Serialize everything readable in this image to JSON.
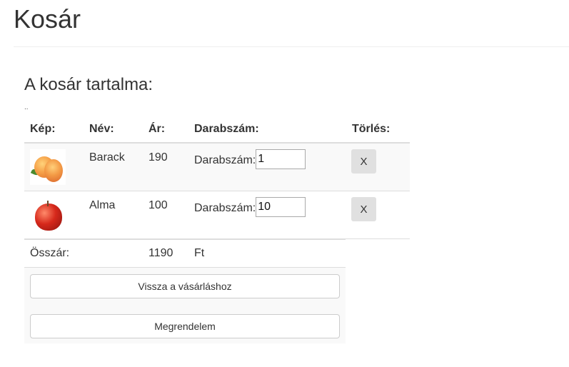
{
  "page": {
    "title": "Kosár",
    "subtitle": "A kosár tartalma:",
    "stray_text": ".."
  },
  "table": {
    "headers": {
      "image": "Kép:",
      "name": "Név:",
      "price": "Ár:",
      "quantity": "Darabszám:",
      "delete": "Törlés:"
    },
    "rows": [
      {
        "icon": "peach-icon",
        "name": "Barack",
        "price": "190",
        "qty_label": "Darabszám:",
        "qty_value": "1",
        "delete_label": "X"
      },
      {
        "icon": "apple-icon",
        "name": "Alma",
        "price": "100",
        "qty_label": "Darabszám:",
        "qty_value": "10",
        "delete_label": "X"
      }
    ],
    "total": {
      "label": "Összár:",
      "value": "1190",
      "currency": "Ft"
    }
  },
  "actions": {
    "back_label": "Vissza a vásárláshoz",
    "order_label": "Megrendelem"
  }
}
